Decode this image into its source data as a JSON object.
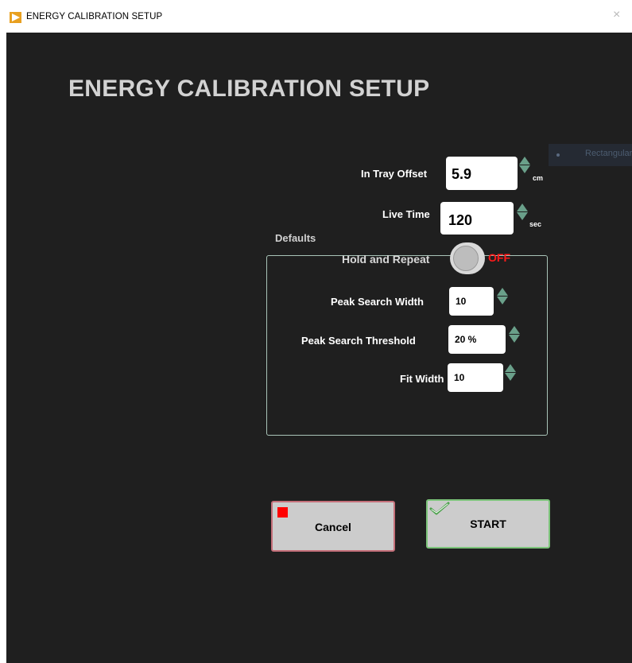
{
  "window": {
    "title": "ENERGY CALIBRATION SETUP",
    "close_glyph": "×"
  },
  "heading": "ENERGY CALIBRATION  SETUP",
  "ghost_label": "Rectangular",
  "in_tray_offset": {
    "label": "In Tray Offset",
    "value": "5.9",
    "unit": "cm"
  },
  "live_time": {
    "label": "Live Time",
    "value": "120",
    "unit": "sec"
  },
  "defaults": {
    "title": "Defaults",
    "hold_and_repeat": {
      "label": "Hold and Repeat",
      "state": "OFF"
    },
    "peak_search_width": {
      "label": "Peak Search Width",
      "value": "10"
    },
    "peak_search_threshold": {
      "label": "Peak Search Threshold",
      "value": "20 %"
    },
    "fit_width": {
      "label": "Fit Width",
      "value": "10"
    }
  },
  "buttons": {
    "cancel": "Cancel",
    "start": "START"
  },
  "icons": {
    "app": "labview-run-icon",
    "cancel": "stop-icon",
    "start": "checkmark-icon",
    "spinner": "up-down-arrows-icon"
  },
  "colors": {
    "background": "#1f1f1f",
    "accent_off": "#ff1a1a",
    "spinner": "#6aa08a",
    "cancel_border": "#c5707a",
    "start_border": "#7cc47a"
  }
}
